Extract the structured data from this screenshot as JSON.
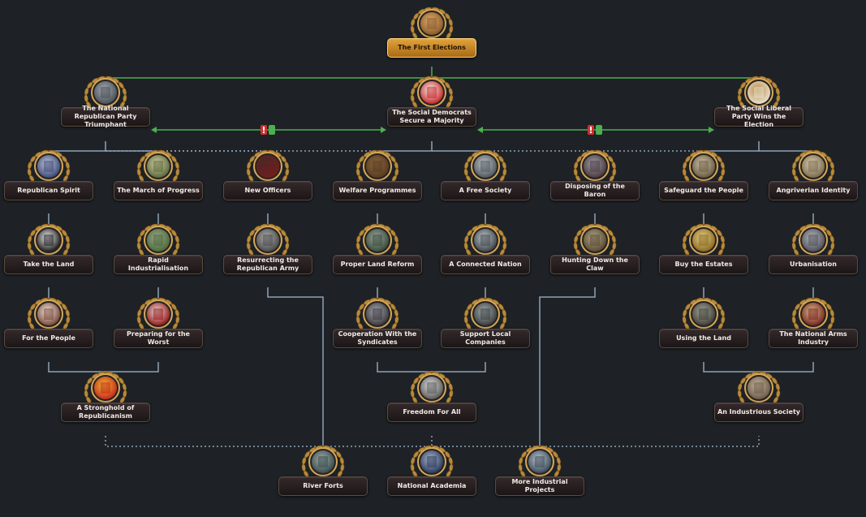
{
  "colors": {
    "background": "#1e2226",
    "line": "#8ea2b6",
    "mutex": "#4caf50",
    "exclusive": "#d32f2f",
    "label_bg": "#2a2122",
    "root_label_bg": "#d18a28"
  },
  "focuses": {
    "first_elections": {
      "label": "The First Elections",
      "icon": "ballot-box-icon"
    },
    "national_republican": {
      "label": "The National Republican Party Triumphant",
      "icon": "fasces-icon"
    },
    "social_democrats": {
      "label": "The Social Democrats Secure a Majority",
      "icon": "red-rose-icon"
    },
    "social_liberal": {
      "label": "The Social Liberal Party Wins the Election",
      "icon": "caduceus-icon"
    },
    "republican_spirit": {
      "label": "Republican Spirit",
      "icon": "eagle-icon"
    },
    "march_of_progress": {
      "label": "The March of Progress",
      "icon": "flask-icon"
    },
    "new_officers": {
      "label": "New Officers",
      "icon": "officer-cap-icon"
    },
    "welfare_programmes": {
      "label": "Welfare Programmes",
      "icon": "briefcase-icon"
    },
    "free_society": {
      "label": "A Free Society",
      "icon": "liberty-statue-icon"
    },
    "disposing_baron": {
      "label": "Disposing of the Baron",
      "icon": "crossed-portrait-icon"
    },
    "safeguard_people": {
      "label": "Safeguard the People",
      "icon": "shield-leaf-icon"
    },
    "angriverian_identity": {
      "label": "Angriverian Identity",
      "icon": "sword-icon"
    },
    "take_the_land": {
      "label": "Take the Land",
      "icon": "skull-icon"
    },
    "rapid_industrialisation": {
      "label": "Rapid Industrialisation",
      "icon": "factory-blocks-icon"
    },
    "resurrecting_army": {
      "label": "Resurrecting the Republican Army",
      "icon": "soldier-icon"
    },
    "proper_land_reform": {
      "label": "Proper Land Reform",
      "icon": "farm-field-icon"
    },
    "connected_nation": {
      "label": "A Connected Nation",
      "icon": "city-building-icon"
    },
    "hunting_claw": {
      "label": "Hunting Down the Claw",
      "icon": "soldiers-icon"
    },
    "buy_estates": {
      "label": "Buy the Estates",
      "icon": "handshake-gold-icon"
    },
    "urbanisation": {
      "label": "Urbanisation",
      "icon": "industry-icon"
    },
    "for_the_people": {
      "label": "For the People",
      "icon": "document-icon"
    },
    "preparing_worst": {
      "label": "Preparing for the Worst",
      "icon": "rocket-icon"
    },
    "cooperation_syndicates": {
      "label": "Cooperation With the Syndicates",
      "icon": "handshake-icon"
    },
    "support_companies": {
      "label": "Support Local Companies",
      "icon": "factory-icon"
    },
    "using_the_land": {
      "label": "Using the Land",
      "icon": "buildings-icon"
    },
    "national_arms": {
      "label": "The National Arms Industry",
      "icon": "artillery-shells-icon"
    },
    "stronghold_republicanism": {
      "label": "A Stronghold of Republicanism",
      "icon": "flag-shield-icon"
    },
    "freedom_for_all": {
      "label": "Freedom For All",
      "icon": "parliament-icon"
    },
    "industrious_society": {
      "label": "An Industrious Society",
      "icon": "statue-icon"
    },
    "river_forts": {
      "label": "River Forts",
      "icon": "fortress-icon"
    },
    "national_academia": {
      "label": "National Academia",
      "icon": "brain-icon"
    },
    "industrial_projects": {
      "label": "More Industrial Projects",
      "icon": "handshake-blue-icon"
    }
  }
}
